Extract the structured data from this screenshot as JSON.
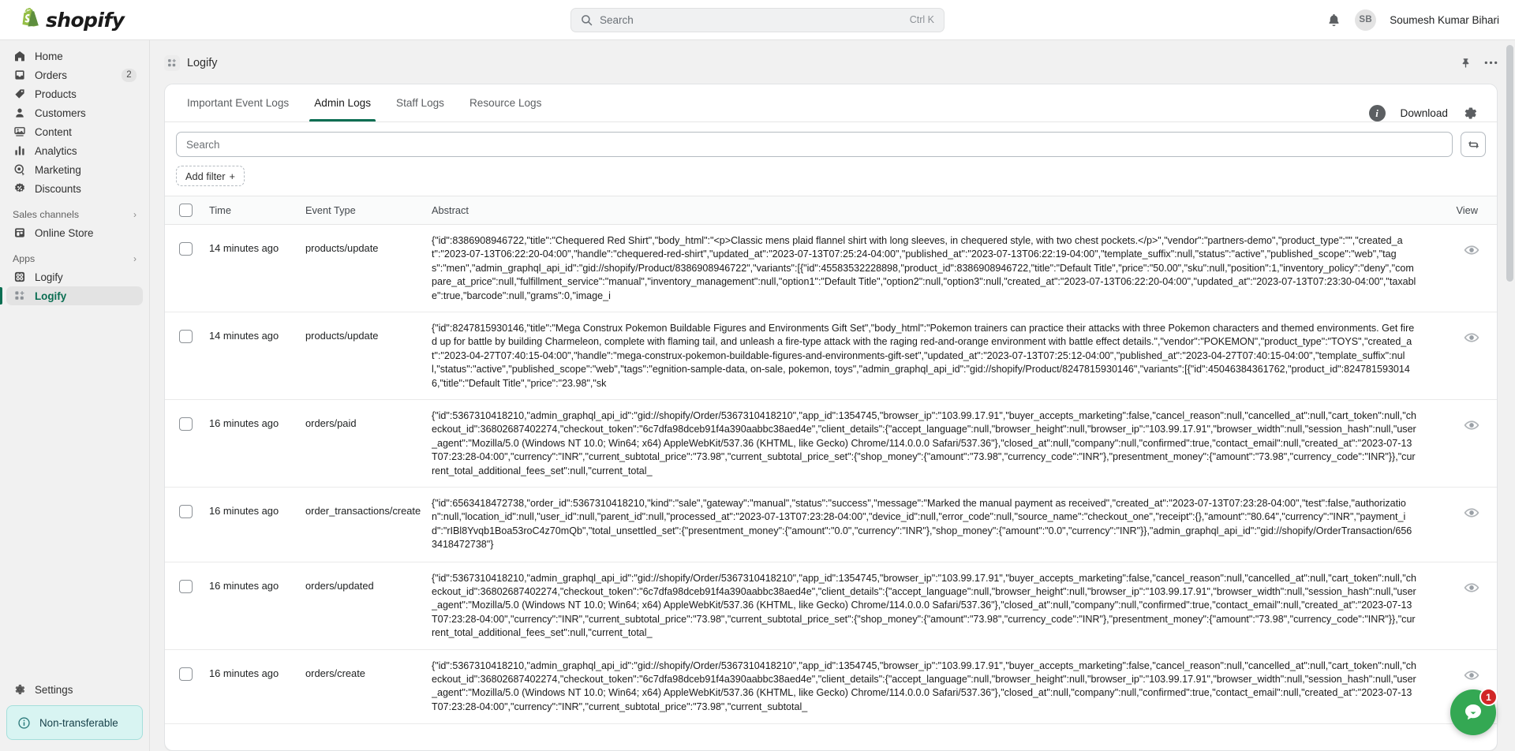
{
  "topbar": {
    "brand": "shopify",
    "search": {
      "placeholder": "Search",
      "shortcut": "Ctrl K",
      "icon": "search-icon"
    },
    "notifications_icon": "bell-icon",
    "user": {
      "initials": "SB",
      "name": "Soumesh Kumar Bihari"
    }
  },
  "sidebar": {
    "items": [
      {
        "label": "Home",
        "icon": "home-icon",
        "badge": ""
      },
      {
        "label": "Orders",
        "icon": "orders-inbox-icon",
        "badge": "2"
      },
      {
        "label": "Products",
        "icon": "tag-icon",
        "badge": ""
      },
      {
        "label": "Customers",
        "icon": "person-icon",
        "badge": ""
      },
      {
        "label": "Content",
        "icon": "content-image-icon",
        "badge": ""
      },
      {
        "label": "Analytics",
        "icon": "bar-chart-icon",
        "badge": ""
      },
      {
        "label": "Marketing",
        "icon": "megaphone-target-icon",
        "badge": ""
      },
      {
        "label": "Discounts",
        "icon": "discount-percent-icon",
        "badge": ""
      }
    ],
    "sales_channels": {
      "heading": "Sales channels",
      "chevron": "chevron-right-icon",
      "items": [
        {
          "label": "Online Store",
          "icon": "storefront-icon"
        }
      ]
    },
    "apps": {
      "heading": "Apps",
      "chevron": "chevron-right-icon",
      "items": [
        {
          "label": "Logify",
          "icon": "apps-grid-icon",
          "active": false
        },
        {
          "label": "Logify",
          "icon": "logify-app-icon",
          "active": true
        }
      ]
    },
    "settings": {
      "label": "Settings",
      "icon": "gear-icon"
    },
    "non_transferable": {
      "label": "Non-transferable",
      "icon": "info-icon",
      "accent": "#d8f4f2"
    }
  },
  "page": {
    "title": "Logify",
    "app_icon": "logify-app-icon",
    "pin_icon": "pin-icon",
    "more_icon": "ellipsis-horizontal-icon"
  },
  "tabs": [
    {
      "label": "Important Event Logs",
      "active": false
    },
    {
      "label": "Admin Logs",
      "active": true
    },
    {
      "label": "Staff Logs",
      "active": false
    },
    {
      "label": "Resource Logs",
      "active": false
    }
  ],
  "toolbar": {
    "info_icon": "info-icon",
    "info_glyph": "i",
    "download_label": "Download",
    "settings_icon": "gear-icon"
  },
  "filters": {
    "search_placeholder": "Search",
    "search_value": "",
    "refresh_icon": "refresh-sync-icon",
    "add_filter_label": "Add filter",
    "add_filter_plus": "+"
  },
  "table": {
    "columns": {
      "select": "",
      "time": "Time",
      "event_type": "Event Type",
      "abstract": "Abstract",
      "view": "View"
    },
    "view_icon": "eye-icon",
    "rows": [
      {
        "time": "14 minutes ago",
        "event_type": "products/update",
        "abstract": "{\"id\":8386908946722,\"title\":\"Chequered Red Shirt\",\"body_html\":\"<p>Classic mens plaid flannel shirt with long sleeves, in chequered style, with two chest pockets.</p>\",\"vendor\":\"partners-demo\",\"product_type\":\"\",\"created_at\":\"2023-07-13T06:22:20-04:00\",\"handle\":\"chequered-red-shirt\",\"updated_at\":\"2023-07-13T07:25:24-04:00\",\"published_at\":\"2023-07-13T06:22:19-04:00\",\"template_suffix\":null,\"status\":\"active\",\"published_scope\":\"web\",\"tags\":\"men\",\"admin_graphql_api_id\":\"gid://shopify/Product/8386908946722\",\"variants\":[{\"id\":45583532228898,\"product_id\":8386908946722,\"title\":\"Default Title\",\"price\":\"50.00\",\"sku\":null,\"position\":1,\"inventory_policy\":\"deny\",\"compare_at_price\":null,\"fulfillment_service\":\"manual\",\"inventory_management\":null,\"option1\":\"Default Title\",\"option2\":null,\"option3\":null,\"created_at\":\"2023-07-13T06:22:20-04:00\",\"updated_at\":\"2023-07-13T07:23:30-04:00\",\"taxable\":true,\"barcode\":null,\"grams\":0,\"image_i"
      },
      {
        "time": "14 minutes ago",
        "event_type": "products/update",
        "abstract": "{\"id\":8247815930146,\"title\":\"Mega Construx Pokemon Buildable Figures and Environments Gift Set\",\"body_html\":\"Pokemon trainers can practice their attacks with three Pokemon characters and themed environments. Get fired up for battle by building Charmeleon, complete with flaming tail, and unleash a fire-type attack with the raging red-and-orange environment with battle effect details.\",\"vendor\":\"POKEMON\",\"product_type\":\"TOYS\",\"created_at\":\"2023-04-27T07:40:15-04:00\",\"handle\":\"mega-construx-pokemon-buildable-figures-and-environments-gift-set\",\"updated_at\":\"2023-07-13T07:25:12-04:00\",\"published_at\":\"2023-04-27T07:40:15-04:00\",\"template_suffix\":null,\"status\":\"active\",\"published_scope\":\"web\",\"tags\":\"egnition-sample-data, on-sale, pokemon, toys\",\"admin_graphql_api_id\":\"gid://shopify/Product/8247815930146\",\"variants\":[{\"id\":45046384361762,\"product_id\":8247815930146,\"title\":\"Default Title\",\"price\":\"23.98\",\"sk"
      },
      {
        "time": "16 minutes ago",
        "event_type": "orders/paid",
        "abstract": "{\"id\":5367310418210,\"admin_graphql_api_id\":\"gid://shopify/Order/5367310418210\",\"app_id\":1354745,\"browser_ip\":\"103.99.17.91\",\"buyer_accepts_marketing\":false,\"cancel_reason\":null,\"cancelled_at\":null,\"cart_token\":null,\"checkout_id\":36802687402274,\"checkout_token\":\"6c7dfa98dceb91f4a390aabbc38aed4e\",\"client_details\":{\"accept_language\":null,\"browser_height\":null,\"browser_ip\":\"103.99.17.91\",\"browser_width\":null,\"session_hash\":null,\"user_agent\":\"Mozilla/5.0 (Windows NT 10.0; Win64; x64) AppleWebKit/537.36 (KHTML, like Gecko) Chrome/114.0.0.0 Safari/537.36\"},\"closed_at\":null,\"company\":null,\"confirmed\":true,\"contact_email\":null,\"created_at\":\"2023-07-13T07:23:28-04:00\",\"currency\":\"INR\",\"current_subtotal_price\":\"73.98\",\"current_subtotal_price_set\":{\"shop_money\":{\"amount\":\"73.98\",\"currency_code\":\"INR\"},\"presentment_money\":{\"amount\":\"73.98\",\"currency_code\":\"INR\"}},\"current_total_additional_fees_set\":null,\"current_total_"
      },
      {
        "time": "16 minutes ago",
        "event_type": "order_transactions/create",
        "abstract": "{\"id\":6563418472738,\"order_id\":5367310418210,\"kind\":\"sale\",\"gateway\":\"manual\",\"status\":\"success\",\"message\":\"Marked the manual payment as received\",\"created_at\":\"2023-07-13T07:23:28-04:00\",\"test\":false,\"authorization\":null,\"location_id\":null,\"user_id\":null,\"parent_id\":null,\"processed_at\":\"2023-07-13T07:23:28-04:00\",\"device_id\":null,\"error_code\":null,\"source_name\":\"checkout_one\",\"receipt\":{},\"amount\":\"80.64\",\"currency\":\"INR\",\"payment_id\":\"rIBl8Yvqb1Boa53roC4z70mQb\",\"total_unsettled_set\":{\"presentment_money\":{\"amount\":\"0.0\",\"currency\":\"INR\"},\"shop_money\":{\"amount\":\"0.0\",\"currency\":\"INR\"}},\"admin_graphql_api_id\":\"gid://shopify/OrderTransaction/6563418472738\"}"
      },
      {
        "time": "16 minutes ago",
        "event_type": "orders/updated",
        "abstract": "{\"id\":5367310418210,\"admin_graphql_api_id\":\"gid://shopify/Order/5367310418210\",\"app_id\":1354745,\"browser_ip\":\"103.99.17.91\",\"buyer_accepts_marketing\":false,\"cancel_reason\":null,\"cancelled_at\":null,\"cart_token\":null,\"checkout_id\":36802687402274,\"checkout_token\":\"6c7dfa98dceb91f4a390aabbc38aed4e\",\"client_details\":{\"accept_language\":null,\"browser_height\":null,\"browser_ip\":\"103.99.17.91\",\"browser_width\":null,\"session_hash\":null,\"user_agent\":\"Mozilla/5.0 (Windows NT 10.0; Win64; x64) AppleWebKit/537.36 (KHTML, like Gecko) Chrome/114.0.0.0 Safari/537.36\"},\"closed_at\":null,\"company\":null,\"confirmed\":true,\"contact_email\":null,\"created_at\":\"2023-07-13T07:23:28-04:00\",\"currency\":\"INR\",\"current_subtotal_price\":\"73.98\",\"current_subtotal_price_set\":{\"shop_money\":{\"amount\":\"73.98\",\"currency_code\":\"INR\"},\"presentment_money\":{\"amount\":\"73.98\",\"currency_code\":\"INR\"}},\"current_total_additional_fees_set\":null,\"current_total_"
      },
      {
        "time": "16 minutes ago",
        "event_type": "orders/create",
        "abstract": "{\"id\":5367310418210,\"admin_graphql_api_id\":\"gid://shopify/Order/5367310418210\",\"app_id\":1354745,\"browser_ip\":\"103.99.17.91\",\"buyer_accepts_marketing\":false,\"cancel_reason\":null,\"cancelled_at\":null,\"cart_token\":null,\"checkout_id\":36802687402274,\"checkout_token\":\"6c7dfa98dceb91f4a390aabbc38aed4e\",\"client_details\":{\"accept_language\":null,\"browser_height\":null,\"browser_ip\":\"103.99.17.91\",\"browser_width\":null,\"session_hash\":null,\"user_agent\":\"Mozilla/5.0 (Windows NT 10.0; Win64; x64) AppleWebKit/537.36 (KHTML, like Gecko) Chrome/114.0.0.0 Safari/537.36\"},\"closed_at\":null,\"company\":null,\"confirmed\":true,\"contact_email\":null,\"created_at\":\"2023-07-13T07:23:28-04:00\",\"currency\":\"INR\",\"current_subtotal_price\":\"73.98\",\"current_subtotal_"
      }
    ]
  },
  "chat": {
    "icon": "chat-bubble-icon",
    "badge": "1",
    "color": "#34a853"
  }
}
